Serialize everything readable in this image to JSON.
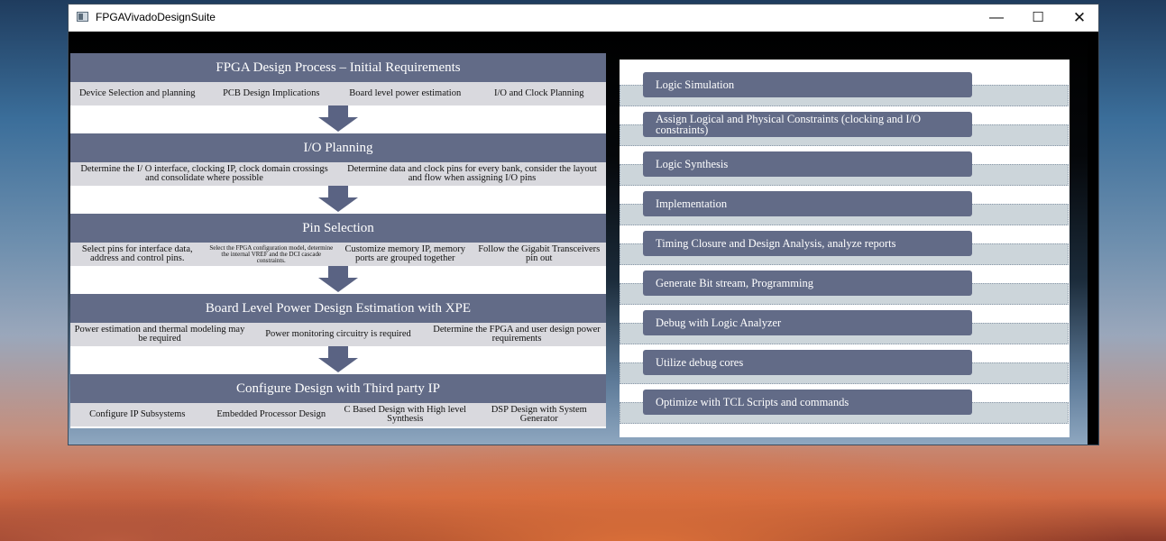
{
  "window": {
    "title": "FPGAVivadoDesignSuite",
    "controls": {
      "minimize": "—",
      "maximize": "☐",
      "close": "✕"
    }
  },
  "stages": [
    {
      "title": "FPGA Design Process – Initial Requirements",
      "items": [
        "Device Selection and planning",
        "PCB Design Implications",
        "Board level power estimation",
        "I/O and Clock Planning"
      ]
    },
    {
      "title": "I/O Planning",
      "items": [
        "Determine the I/ O interface, clocking IP, clock domain crossings and consolidate where possible",
        "Determine data and clock pins for every  bank, consider the layout and flow when assigning I/O pins"
      ]
    },
    {
      "title": "Pin Selection",
      "items": [
        "Select pins for interface data, address and control pins.",
        "Select the FPGA configuration model, determine the internal VREF and the DCI cascade constraints.",
        "Customize memory IP, memory ports are grouped together",
        "Follow the Gigabit Transceivers pin out"
      ]
    },
    {
      "title": "Board Level Power Design Estimation with XPE",
      "items": [
        "Power estimation and thermal modeling may be required",
        "Power monitoring circuitry is required",
        "Determine the FPGA and user design power requirements"
      ]
    },
    {
      "title": "Configure Design with Third party IP",
      "items": [
        "Configure IP Subsystems",
        "Embedded Processor Design",
        "C Based Design with High level Synthesis",
        "DSP Design with System Generator"
      ]
    }
  ],
  "steps": [
    "Logic Simulation",
    "Assign Logical and Physical Constraints (clocking and I/O constraints)",
    "Logic Synthesis",
    "Implementation",
    "Timing Closure and Design Analysis, analyze reports",
    "Generate Bit stream, Programming",
    "Debug with Logic Analyzer",
    "Utilize debug cores",
    "Optimize with TCL Scripts and commands"
  ],
  "colors": {
    "header": "#626b87",
    "row": "#d9d9de",
    "arrow": "#5a6383",
    "band": "#ccd5da"
  }
}
